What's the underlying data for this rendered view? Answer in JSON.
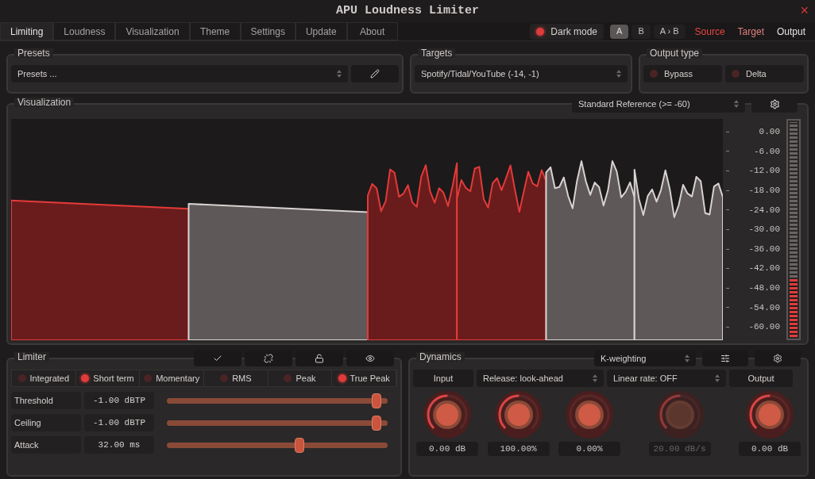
{
  "window": {
    "title": "APU Loudness Limiter",
    "close": "×"
  },
  "tabs": [
    {
      "label": "Limiting",
      "selected": true
    },
    {
      "label": "Loudness",
      "selected": false
    },
    {
      "label": "Visualization",
      "selected": false
    },
    {
      "label": "Theme",
      "selected": false
    },
    {
      "label": "Settings",
      "selected": false
    },
    {
      "label": "Update",
      "selected": false
    },
    {
      "label": "About",
      "selected": false
    }
  ],
  "dark_mode": {
    "label": "Dark mode",
    "checked": true
  },
  "ab": [
    {
      "label": "A",
      "selected": true
    },
    {
      "label": "B",
      "selected": false
    },
    {
      "label": "A › B",
      "selected": false
    }
  ],
  "views": [
    {
      "label": "Source",
      "color": "#e84545"
    },
    {
      "label": "Target",
      "color": "#e08080"
    },
    {
      "label": "Output",
      "color": "#e8e4e4"
    }
  ],
  "presets": {
    "title": "Presets",
    "value": "Presets ..."
  },
  "targets": {
    "title": "Targets",
    "value": "Spotify/Tidal/YouTube (-14, -1)"
  },
  "output_type": {
    "title": "Output type",
    "options": [
      {
        "label": "Bypass",
        "checked": false
      },
      {
        "label": "Delta",
        "checked": false
      }
    ]
  },
  "visualization": {
    "title": "Visualization",
    "reference": "Standard Reference (>= -60)",
    "scale": [
      "0.00",
      "-6.00",
      "-12.00",
      "-18.00",
      "-24.00",
      "-30.00",
      "-36.00",
      "-42.00",
      "-48.00",
      "-54.00",
      "-60.00"
    ],
    "meter": {
      "level": 0.27
    }
  },
  "limiter": {
    "title": "Limiter",
    "modes": [
      {
        "label": "Integrated",
        "checked": false
      },
      {
        "label": "Short term",
        "checked": true
      },
      {
        "label": "Momentary",
        "checked": false
      },
      {
        "label": "RMS",
        "checked": false
      },
      {
        "label": "Peak",
        "checked": false
      },
      {
        "label": "True Peak",
        "checked": true
      }
    ],
    "params": [
      {
        "label": "Threshold",
        "value": "-1.00 dBTP",
        "level": 0.95
      },
      {
        "label": "Ceiling",
        "value": "-1.00 dBTP",
        "level": 0.95
      },
      {
        "label": "Attack",
        "value": "32.00 ms",
        "level": 0.6
      }
    ]
  },
  "dynamics": {
    "title": "Dynamics",
    "weighting": "K-weighting",
    "headers": [
      {
        "kind": "label",
        "text": "Input"
      },
      {
        "kind": "select",
        "text": "Release: look-ahead"
      },
      {
        "kind": "select",
        "text": "Linear rate: OFF"
      },
      {
        "kind": "label",
        "text": "Output"
      }
    ],
    "knobs": [
      {
        "value": "0.00 dB",
        "level": 0.5,
        "disabled": false
      },
      {
        "value": "100.00%",
        "level": 0.5,
        "disabled": false
      },
      {
        "value": "0.00%",
        "level": 0,
        "disabled": false
      },
      {
        "value": "20.00 dB/s",
        "level": 0.5,
        "disabled": true
      },
      {
        "value": "0.00 dB",
        "level": 0.5,
        "disabled": false
      }
    ]
  }
}
